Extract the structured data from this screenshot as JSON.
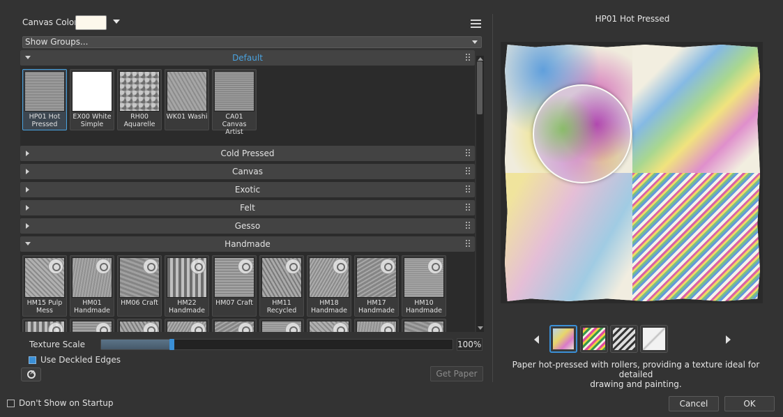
{
  "top_bar": {
    "canvas_color_label": "Canvas Color",
    "canvas_color_value": "#fdf8ec",
    "show_groups_label": "Show Groups..."
  },
  "groups": [
    {
      "label": "Default",
      "expanded": true,
      "active": true
    },
    {
      "label": "Cold Pressed",
      "expanded": false
    },
    {
      "label": "Canvas",
      "expanded": false
    },
    {
      "label": "Exotic",
      "expanded": false
    },
    {
      "label": "Felt",
      "expanded": false
    },
    {
      "label": "Gesso",
      "expanded": false
    },
    {
      "label": "Handmade",
      "expanded": true
    }
  ],
  "default_papers": [
    {
      "line1": "HP01 Hot",
      "line2": "Pressed",
      "selected": true
    },
    {
      "line1": "EX00 White",
      "line2": "Simple"
    },
    {
      "line1": "RH00",
      "line2": "Aquarelle"
    },
    {
      "line1": "WK01 Washi",
      "line2": ""
    },
    {
      "line1": "CA01 Canvas",
      "line2": "Artist"
    }
  ],
  "handmade_papers": [
    {
      "line1": "HM15 Pulp",
      "line2": "Mess"
    },
    {
      "line1": "HM01",
      "line2": "Handmade"
    },
    {
      "line1": "HM06 Craft",
      "line2": ""
    },
    {
      "line1": "HM22",
      "line2": "Handmade"
    },
    {
      "line1": "HM07 Craft",
      "line2": ""
    },
    {
      "line1": "HM11",
      "line2": "Recycled"
    },
    {
      "line1": "HM18",
      "line2": "Handmade ..."
    },
    {
      "line1": "HM17",
      "line2": "Handmade ..."
    },
    {
      "line1": "HM10",
      "line2": "Handmade"
    }
  ],
  "texture_scale": {
    "label": "Texture Scale",
    "value_text": "100%",
    "fraction": 0.2
  },
  "deckled_edges": {
    "label": "Use Deckled Edges",
    "checked": true
  },
  "get_paper_label": "Get Paper",
  "preview": {
    "title": "HP01 Hot Pressed",
    "description_line1": "Paper hot-pressed with rollers, providing a texture ideal for detailed",
    "description_line2": "drawing and painting."
  },
  "footer": {
    "dont_show_label": "Don't Show on Startup",
    "cancel_label": "Cancel",
    "ok_label": "OK"
  },
  "colors": {
    "accent": "#3a8fd6",
    "active_group_text": "#4aa3e0",
    "background": "#333333"
  }
}
